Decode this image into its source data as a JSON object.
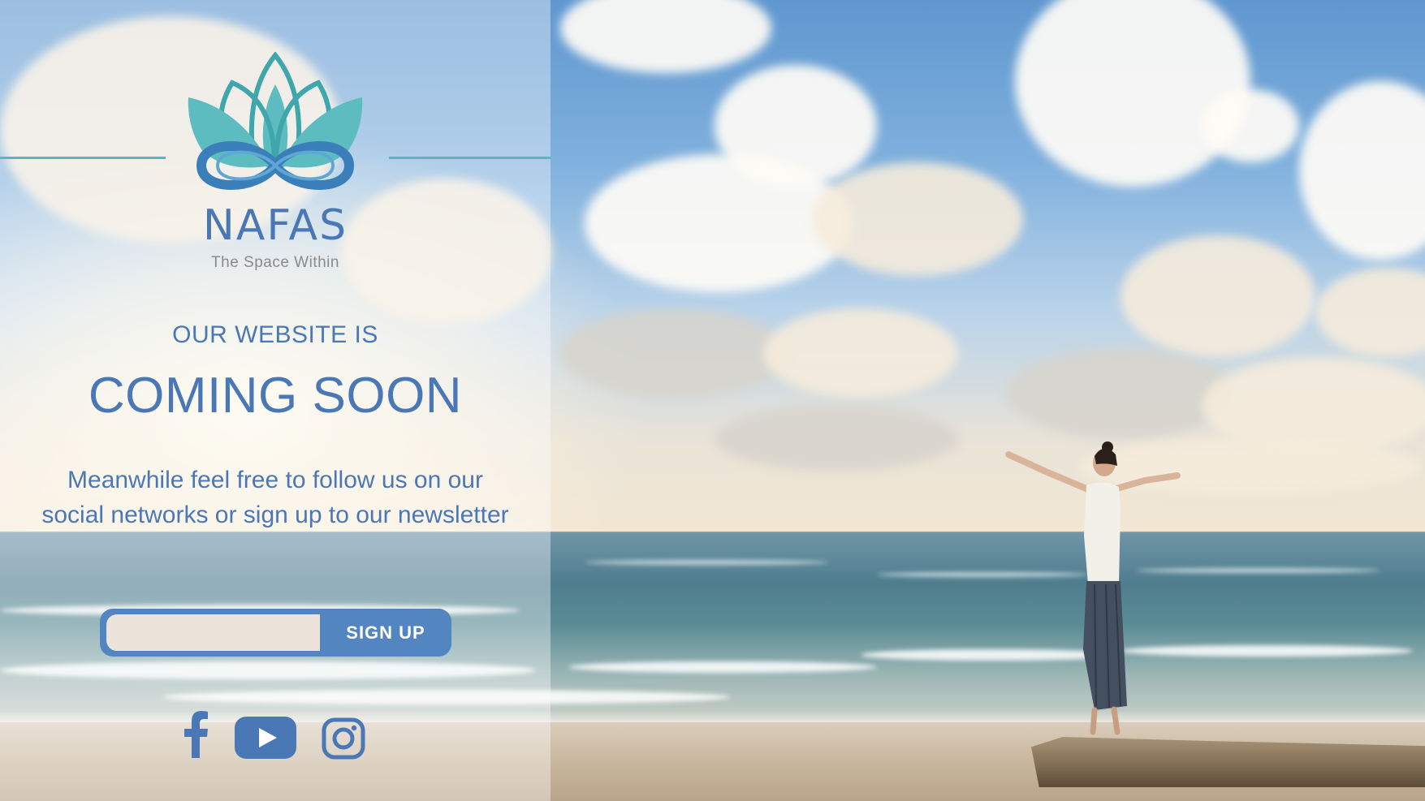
{
  "brand": {
    "name": "NAFAS",
    "tagline": "The Space Within",
    "logo_icon": "lotus-infinity-icon"
  },
  "hero": {
    "eyebrow": "OUR WEBSITE IS",
    "headline": "COMING SOON",
    "message_line1": "Meanwhile feel free to follow us on our",
    "message_line2": "social networks or sign up to our newsletter"
  },
  "newsletter": {
    "email_value": "",
    "button_label": "SIGN UP"
  },
  "social": [
    {
      "name": "facebook-icon"
    },
    {
      "name": "youtube-icon"
    },
    {
      "name": "instagram-icon"
    }
  ],
  "colors": {
    "brand_blue": "#4a78b6",
    "button_blue": "#5386c0",
    "teal": "#5db3be",
    "input_bg": "#ece4da"
  }
}
